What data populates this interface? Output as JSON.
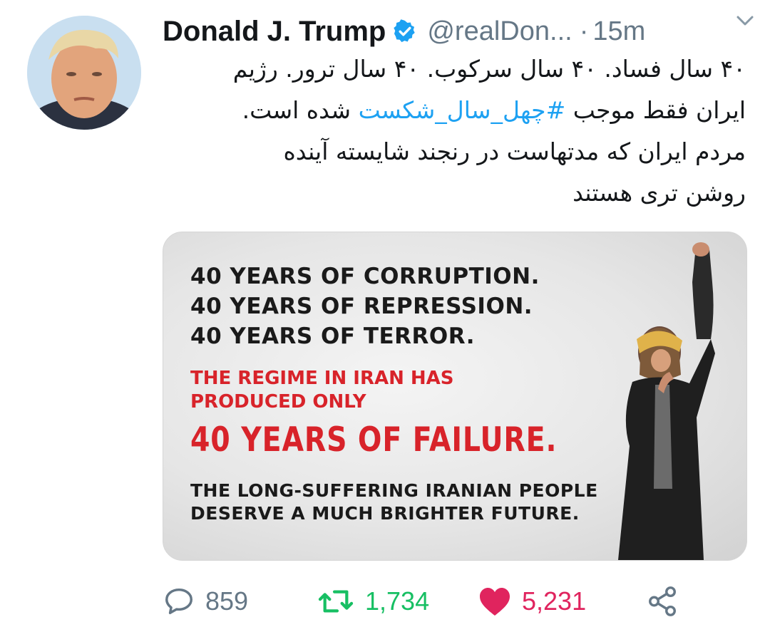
{
  "tweet": {
    "author_name": "Donald J. Trump",
    "handle": "@realDon...",
    "separator": "·",
    "time": "15m",
    "text_lines": [
      {
        "before": "۴۰ سال فساد. ۴۰ سال سرکوب. ۴۰ سال ترور. رژیم",
        "hashtag": "",
        "after": ""
      },
      {
        "before": "ایران فقط موجب ",
        "hashtag": "#چهل_سال_شکست",
        "after": " شده است."
      },
      {
        "before": "مردم ایران که مدتهاست در رنجند شایسته آینده",
        "hashtag": "",
        "after": ""
      },
      {
        "before": "روشن تری هستند",
        "hashtag": "",
        "after": ""
      }
    ]
  },
  "media": {
    "lines_black": [
      "40 YEARS OF CORRUPTION.",
      "40 YEARS OF REPRESSION.",
      "40 YEARS OF TERROR."
    ],
    "lines_red": [
      "THE REGIME IN IRAN HAS",
      "PRODUCED ONLY"
    ],
    "headline": "40 YEARS OF FAILURE.",
    "footer_lines": [
      "THE LONG-SUFFERING IRANIAN PEOPLE",
      "DESERVE A MUCH BRIGHTER FUTURE."
    ]
  },
  "actions": {
    "reply_count": "859",
    "retweet_count": "1,734",
    "like_count": "5,231"
  },
  "colors": {
    "link": "#1da1f2",
    "retweet": "#17bf63",
    "like": "#e0245e",
    "muted": "#657786",
    "poster_red": "#d8232a"
  },
  "icons": [
    "verified-badge-icon",
    "chevron-down-icon",
    "reply-icon",
    "retweet-icon",
    "like-heart-icon",
    "share-icon"
  ]
}
